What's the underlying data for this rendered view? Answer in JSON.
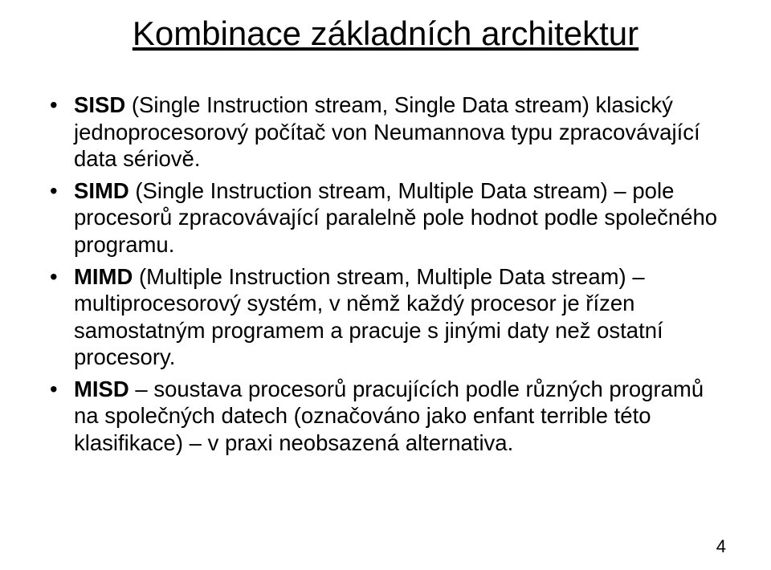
{
  "title": "Kombinace základních architektur",
  "bullets": [
    {
      "strong": "SISD",
      "text": " (Single Instruction stream, Single Data stream) klasický jednoprocesorový počítač von Neumannova typu zpracovávající data sériově."
    },
    {
      "strong": "SIMD",
      "text": " (Single Instruction stream, Multiple Data stream) – pole procesorů zpracovávající paralelně pole hodnot podle společného programu."
    },
    {
      "strong": "MIMD",
      "text": " (Multiple Instruction stream, Multiple Data stream) – multiprocesorový systém, v němž každý procesor je řízen samostatným programem a pracuje s jinými daty než ostatní procesory."
    },
    {
      "strong": "MISD",
      "text": " – soustava procesorů pracujících podle různých programů na společných datech (označováno jako enfant terrible této klasifikace) – v praxi neobsazená alternativa."
    }
  ],
  "page_number": "4"
}
